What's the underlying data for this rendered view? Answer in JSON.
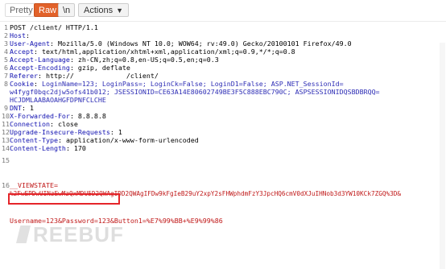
{
  "toolbar": {
    "tabs": [
      "Pretty",
      "Raw",
      "\\n"
    ],
    "actions_label": "Actions",
    "accent": "#e2622a"
  },
  "request_lines": [
    {
      "n": "1",
      "text": "POST /client/ HTTP/1.1"
    },
    {
      "n": "2",
      "key": "Host",
      "text": ""
    },
    {
      "n": "3",
      "key": "User-Agent",
      "text": " Mozilla/5.0 (Windows NT 10.0; WOW64; rv:49.0) Gecko/20100101 Firefox/49.0"
    },
    {
      "n": "4",
      "key": "Accept",
      "text": " text/html,application/xhtml+xml,application/xml;q=0.9,*/*;q=0.8"
    },
    {
      "n": "5",
      "key": "Accept-Language",
      "text": " zh-CN,zh;q=0.8,en-US;q=0.5,en;q=0.3"
    },
    {
      "n": "6",
      "key": "Accept-Encoding",
      "text": " gzip, deflate"
    },
    {
      "n": "7",
      "key": "Referer",
      "text": " http://             /client/"
    },
    {
      "n": "8",
      "key": "Cookie",
      "text": " LoginName=123; LoginPass=; LoginCk=False; LoginD1=False; ASP.NET_SessionId="
    },
    {
      "n": "",
      "text": "w4fygf0bqc2djw5ofs41b012; JSESSIONID=CE63A14E80602749BE3F5C888EBC790C; ASPSESSIONIDQSBDBRQQ="
    },
    {
      "n": "",
      "text": "HCJDMLAABAOAHGFDPNFCLCHE"
    },
    {
      "n": "9",
      "key": "DNT",
      "text": " 1"
    },
    {
      "n": "10",
      "key": "X-Forwarded-For",
      "text": " 8.8.8.8"
    },
    {
      "n": "11",
      "key": "Connection",
      "text": " close"
    },
    {
      "n": "12",
      "key": "Upgrade-Insecure-Requests",
      "text": " 1"
    },
    {
      "n": "13",
      "key": "Content-Type",
      "text": " application/x-www-form-urlencoded"
    },
    {
      "n": "14",
      "key": "Content-Length",
      "text": " 170"
    },
    {
      "n": "15",
      "text": ""
    },
    {
      "n": "16",
      "text": "__VIEWSTATE="
    },
    {
      "n": "",
      "text": "%2FwEPDwUINzEwMzQxMDU5D2QWAgIDD2QWAgIFDw9kFgIeB29uY2xpY2sFHWphdmFzY3JpcHQ6cmV0dXJuIHNob3d3YW10KCk7ZGQ%3D&"
    },
    {
      "n": "",
      "text": "Username=123&Password=123&Button1=%E7%99%BB+%E9%99%86"
    }
  ],
  "watermark": "REEBUF"
}
